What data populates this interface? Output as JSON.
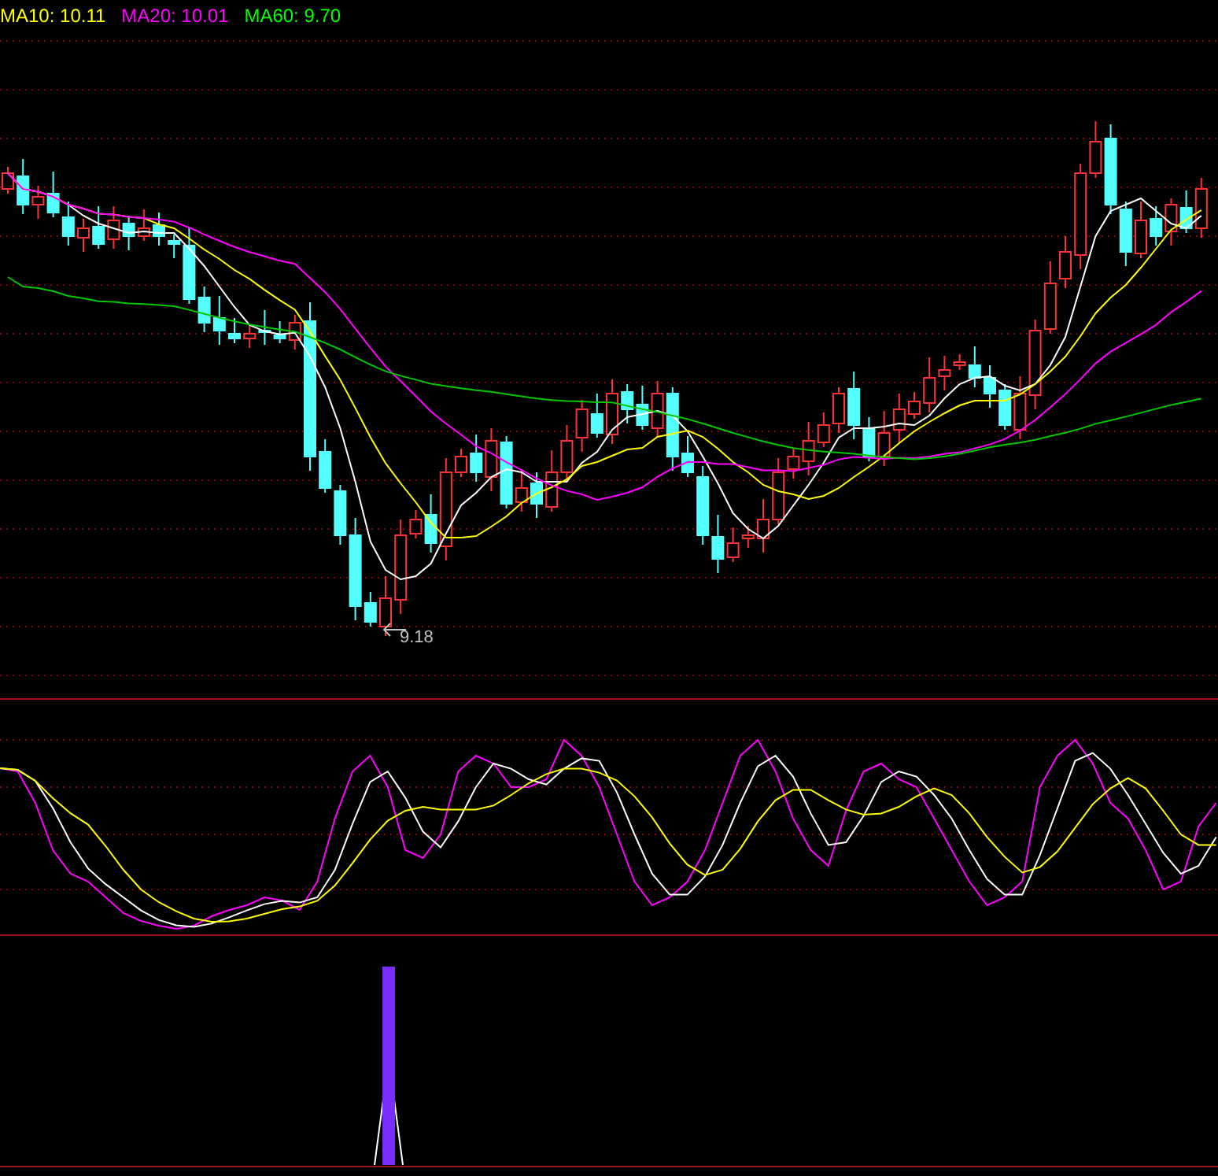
{
  "legend": [
    {
      "label": "MA10: 10.11",
      "color": "#ffff00"
    },
    {
      "label": "MA20: 10.01",
      "color": "#ff00ff"
    },
    {
      "label": "MA60: 9.70",
      "color": "#00ff00"
    }
  ],
  "low_marker": {
    "label": "9.18"
  }
}
